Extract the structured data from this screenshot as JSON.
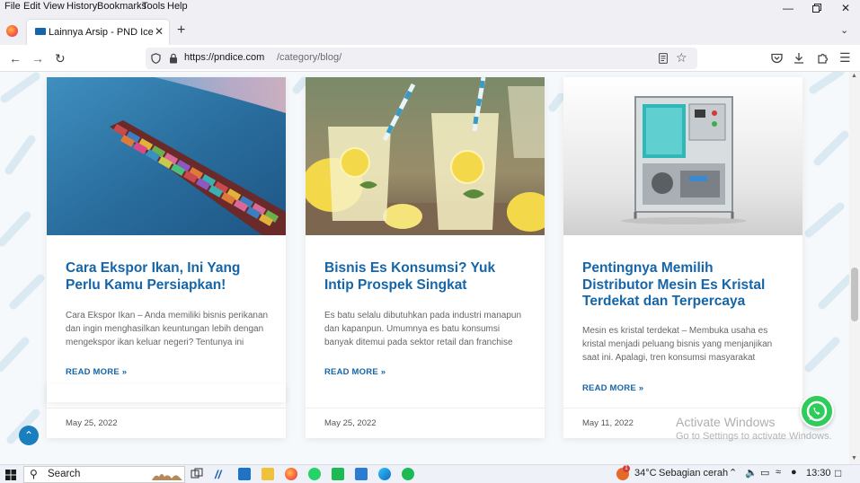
{
  "menubar": {
    "items": [
      "File",
      "Edit",
      "View",
      "History",
      "Bookmarks",
      "Tools",
      "Help"
    ]
  },
  "tab": {
    "title": "Lainnya Arsip - PND Ice"
  },
  "url": {
    "host": "https://pndice.com",
    "path": "/category/blog/"
  },
  "cards": [
    {
      "title": "Cara Ekspor Ikan, Ini Yang Perlu Kamu Persiapkan!",
      "excerpt": "Cara Ekspor Ikan – Anda memiliki bisnis perikanan dan ingin menghasilkan keuntungan lebih dengan mengekspor ikan keluar negeri? Tentunya ini",
      "read_more": "READ MORE »",
      "date": "May 25, 2022",
      "image": "container-ship"
    },
    {
      "title": "Bisnis Es Konsumsi? Yuk Intip Prospek Singkat",
      "excerpt": "Es batu selalu dibutuhkan pada industri manapun dan kapanpun. Umumnya es batu konsumsi banyak ditemui pada sektor retail dan franchise",
      "read_more": "READ MORE »",
      "date": "May 25, 2022",
      "image": "lemonade-glasses"
    },
    {
      "title": "Pentingnya Memilih Distributor Mesin Es Kristal Terdekat dan Terpercaya",
      "excerpt": "Mesin es kristal terdekat – Membuka usaha es kristal menjadi peluang bisnis yang menjanjikan saat ini. Apalagi, tren konsumsi masyarakat",
      "read_more": "READ MORE »",
      "date": "May 11, 2022",
      "image": "ice-machine"
    }
  ],
  "watermark": {
    "line1": "Activate Windows",
    "line2": "Go to Settings to activate Windows."
  },
  "taskbar": {
    "search_label": "Search",
    "temperature": "34°C",
    "weather": "Sebagian cerah",
    "time": "13:30",
    "notification_count": "1"
  },
  "colors": {
    "link_blue": "#1565a8",
    "whatsapp_green": "#2ecc5a"
  }
}
